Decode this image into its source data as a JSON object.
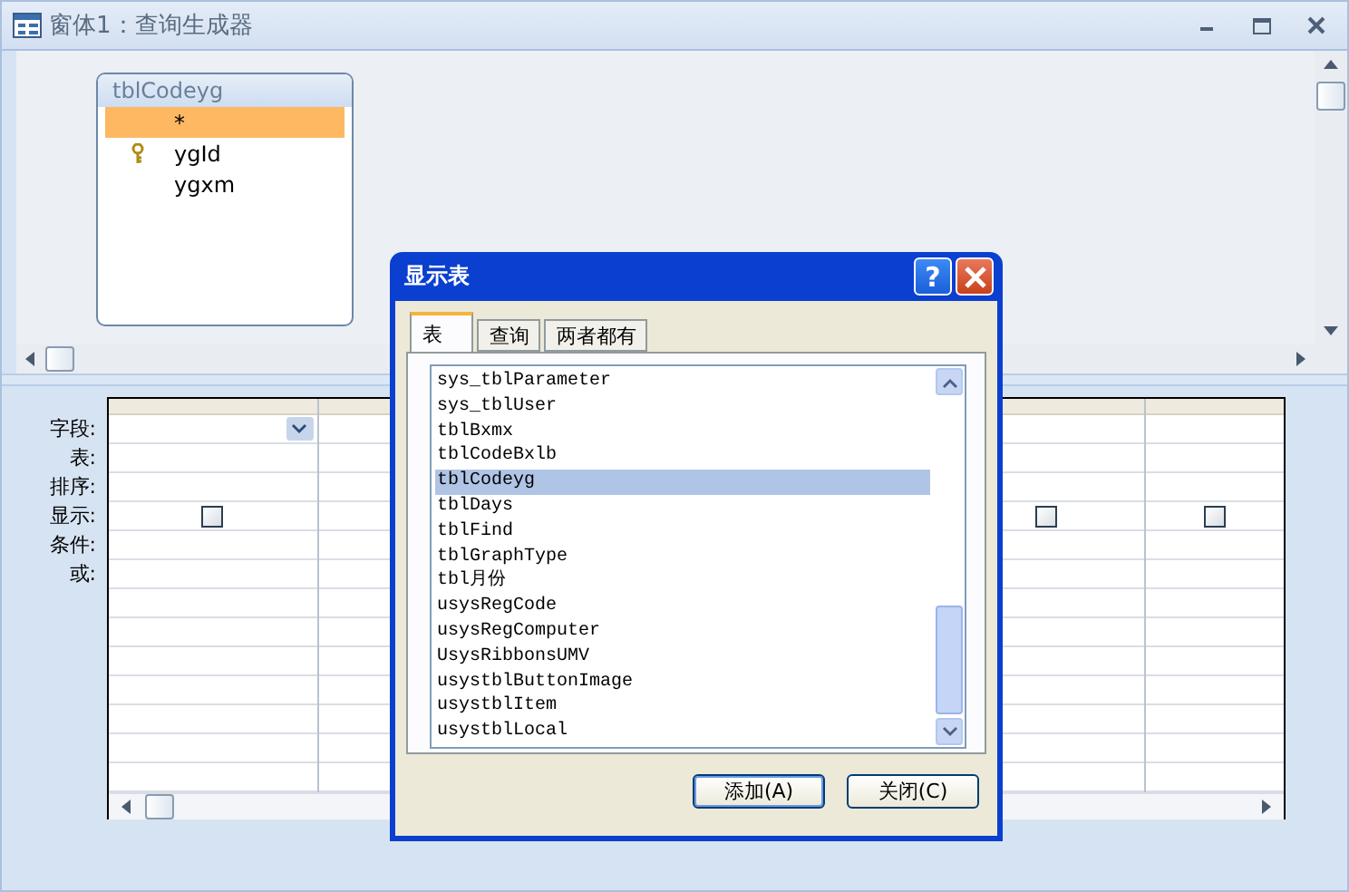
{
  "window": {
    "title": "窗体1：查询生成器"
  },
  "table_box": {
    "title": "tblCodeyg",
    "fields": [
      {
        "name": "*",
        "selected": true,
        "primary_key": false
      },
      {
        "name": "ygId",
        "selected": false,
        "primary_key": true
      },
      {
        "name": "ygxm",
        "selected": false,
        "primary_key": false
      }
    ]
  },
  "grid": {
    "row_labels": [
      "字段:",
      "表:",
      "排序:",
      "显示:",
      "条件:",
      "或:"
    ],
    "columns": [
      {
        "kind": "field",
        "show_checked": false
      },
      {
        "kind": "empty"
      },
      {
        "kind": "covered"
      },
      {
        "kind": "covered"
      },
      {
        "kind": "empty",
        "show_checked": false
      },
      {
        "kind": "empty",
        "show_checked": false
      }
    ]
  },
  "dialog": {
    "title": "显示表",
    "help": "?",
    "tabs": [
      {
        "label": "表",
        "selected": true
      },
      {
        "label": "查询",
        "selected": false
      },
      {
        "label": "两者都有",
        "selected": false
      }
    ],
    "items": [
      {
        "name": "sys_tblParameter",
        "selected": false
      },
      {
        "name": "sys_tblUser",
        "selected": false
      },
      {
        "name": "tblBxmx",
        "selected": false
      },
      {
        "name": "tblCodeBxlb",
        "selected": false
      },
      {
        "name": "tblCodeyg",
        "selected": true
      },
      {
        "name": "tblDays",
        "selected": false
      },
      {
        "name": "tblFind",
        "selected": false
      },
      {
        "name": "tblGraphType",
        "selected": false
      },
      {
        "name": "tbl月份",
        "selected": false
      },
      {
        "name": "usysRegCode",
        "selected": false
      },
      {
        "name": "usysRegComputer",
        "selected": false
      },
      {
        "name": "UsysRibbonsUMV",
        "selected": false
      },
      {
        "name": "usystblButtonImage",
        "selected": false
      },
      {
        "name": "usystblItem",
        "selected": false
      },
      {
        "name": "usystblLocal",
        "selected": false
      }
    ],
    "buttons": [
      "添加(A)",
      "关闭(C)"
    ]
  }
}
